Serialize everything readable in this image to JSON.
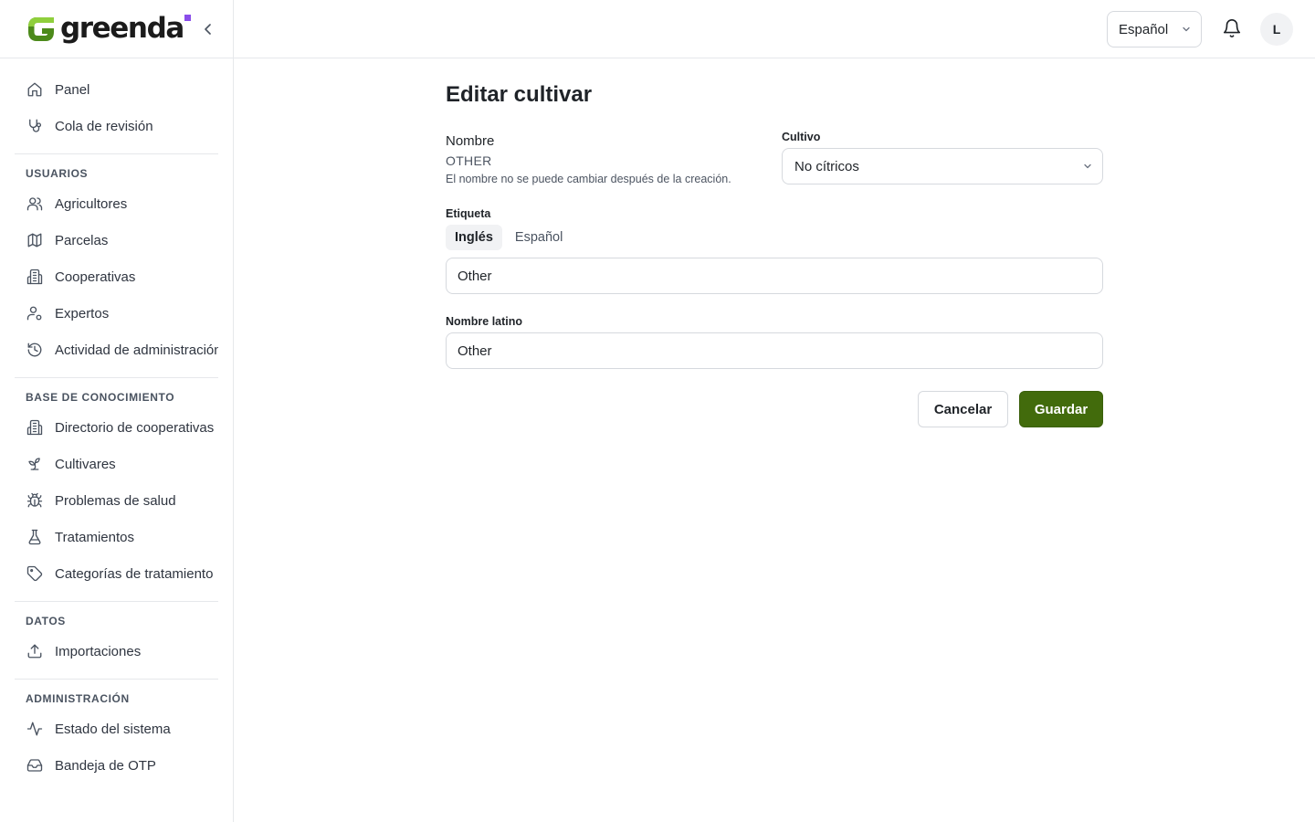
{
  "brand": {
    "name": "greenda",
    "accent": "#8a4dea",
    "logo_green": "#4c8a1a"
  },
  "sidebar": {
    "top_items": [
      {
        "label": "Panel",
        "icon": "home-icon"
      },
      {
        "label": "Cola de revisión",
        "icon": "stethoscope-icon"
      }
    ],
    "sections": [
      {
        "title": "USUARIOS",
        "items": [
          {
            "label": "Agricultores",
            "icon": "users-icon"
          },
          {
            "label": "Parcelas",
            "icon": "map-icon"
          },
          {
            "label": "Cooperativas",
            "icon": "building-icon"
          },
          {
            "label": "Expertos",
            "icon": "user-cog-icon"
          },
          {
            "label": "Actividad de administración",
            "icon": "history-icon"
          }
        ]
      },
      {
        "title": "BASE DE CONOCIMIENTO",
        "items": [
          {
            "label": "Directorio de cooperativas",
            "icon": "building-icon"
          },
          {
            "label": "Cultivares",
            "icon": "sprout-icon"
          },
          {
            "label": "Problemas de salud",
            "icon": "bug-icon"
          },
          {
            "label": "Tratamientos",
            "icon": "flask-icon"
          },
          {
            "label": "Categorías de tratamiento",
            "icon": "tag-icon"
          }
        ]
      },
      {
        "title": "DATOS",
        "items": [
          {
            "label": "Importaciones",
            "icon": "upload-icon"
          }
        ]
      },
      {
        "title": "ADMINISTRACIÓN",
        "items": [
          {
            "label": "Estado del sistema",
            "icon": "activity-icon"
          },
          {
            "label": "Bandeja de OTP",
            "icon": "inbox-icon"
          }
        ]
      }
    ]
  },
  "header": {
    "language": "Español",
    "avatar_initial": "L"
  },
  "main": {
    "title": "Editar cultivar",
    "name_label": "Nombre",
    "name_value": "OTHER",
    "name_help": "El nombre no se puede cambiar después de la creación.",
    "crop_label": "Cultivo",
    "crop_value": "No cítricos",
    "label_label": "Etiqueta",
    "tabs": [
      {
        "label": "Inglés",
        "active": true
      },
      {
        "label": "Español",
        "active": false
      }
    ],
    "label_value": "Other",
    "latin_label": "Nombre latino",
    "latin_value": "Other",
    "cancel_label": "Cancelar",
    "save_label": "Guardar",
    "save_color": "#426b0c"
  }
}
